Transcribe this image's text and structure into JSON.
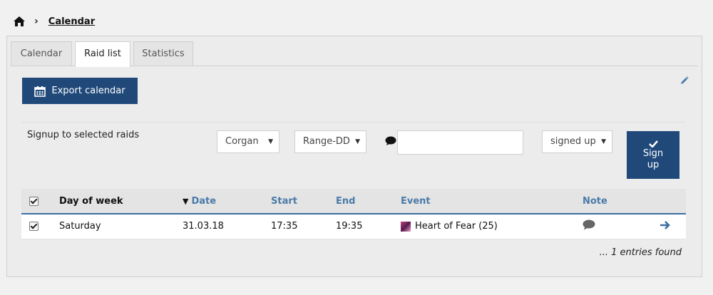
{
  "breadcrumb": {
    "current": "Calendar"
  },
  "tabs": [
    {
      "label": "Calendar"
    },
    {
      "label": "Raid list"
    },
    {
      "label": "Statistics"
    }
  ],
  "toolbar": {
    "export_label": "Export calendar"
  },
  "signup": {
    "label": "Signup to selected raids",
    "character": "Corgan",
    "role": "Range-DD",
    "note_value": "",
    "status": "signed up",
    "button_label": "Sign up"
  },
  "table": {
    "headers": {
      "day": "Day of week",
      "date": "Date",
      "start": "Start",
      "end": "End",
      "event": "Event",
      "note": "Note"
    },
    "sort_indicator": "▼",
    "rows": [
      {
        "day": "Saturday",
        "date": "31.03.18",
        "start": "17:35",
        "end": "19:35",
        "event": "Heart of Fear (25)"
      }
    ]
  },
  "footer": {
    "found": "... 1 entries found"
  },
  "colors": {
    "primary": "#20497a",
    "header_link": "#4a7aa8",
    "rule": "#3b6ea0"
  },
  "icons": [
    "home-icon",
    "chevron-right-icon",
    "calendar-icon",
    "pencil-icon",
    "comment-icon",
    "check-icon",
    "arrow-right-icon",
    "event-icon"
  ]
}
